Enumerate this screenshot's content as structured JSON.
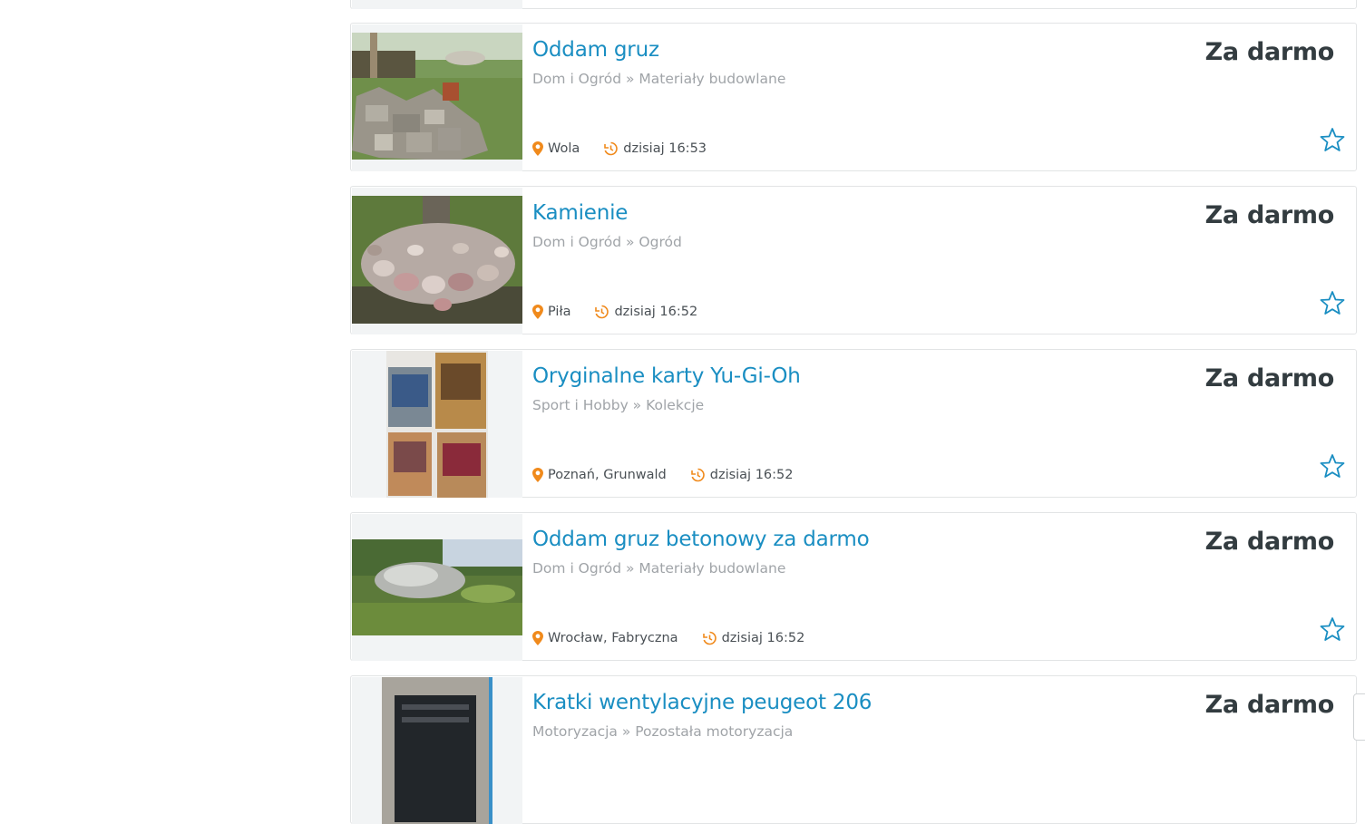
{
  "listings": [
    {
      "title": "",
      "category": "",
      "price": "",
      "location": "",
      "time": ""
    },
    {
      "title": "Oddam gruz",
      "category": "Dom i Ogród » Materiały budowlane",
      "price": "Za darmo",
      "location": "Wola",
      "time": "dzisiaj 16:53",
      "thumbnail": "rubble-in-grass-photo"
    },
    {
      "title": "Kamienie",
      "category": "Dom i Ogród » Ogród",
      "price": "Za darmo",
      "location": "Piła",
      "time": "dzisiaj 16:52",
      "thumbnail": "stones-around-tree-photo"
    },
    {
      "title": "Oryginalne karty Yu-Gi-Oh",
      "category": "Sport i Hobby » Kolekcje",
      "price": "Za darmo",
      "location": "Poznań, Grunwald",
      "time": "dzisiaj 16:52",
      "thumbnail": "trading-cards-photo"
    },
    {
      "title": "Oddam gruz betonowy za darmo",
      "category": "Dom i Ogród » Materiały budowlane",
      "price": "Za darmo",
      "location": "Wrocław, Fabryczna",
      "time": "dzisiaj 16:52",
      "thumbnail": "concrete-rubble-pile-photo"
    },
    {
      "title": "Kratki wentylacyjne peugeot 206",
      "category": "Motoryzacja » Pozostała motoryzacja",
      "price": "Za darmo",
      "thumbnail": "vent-grilles-photo"
    }
  ],
  "icons": {
    "location": "map-pin-icon",
    "time": "history-clock-icon",
    "favorite": "star-outline-icon"
  },
  "colors": {
    "title": "#1a8ec2",
    "price": "#333c40",
    "category": "#a0a4a8",
    "meta_icon": "#f08a1c",
    "star": "#1a8ec2"
  }
}
